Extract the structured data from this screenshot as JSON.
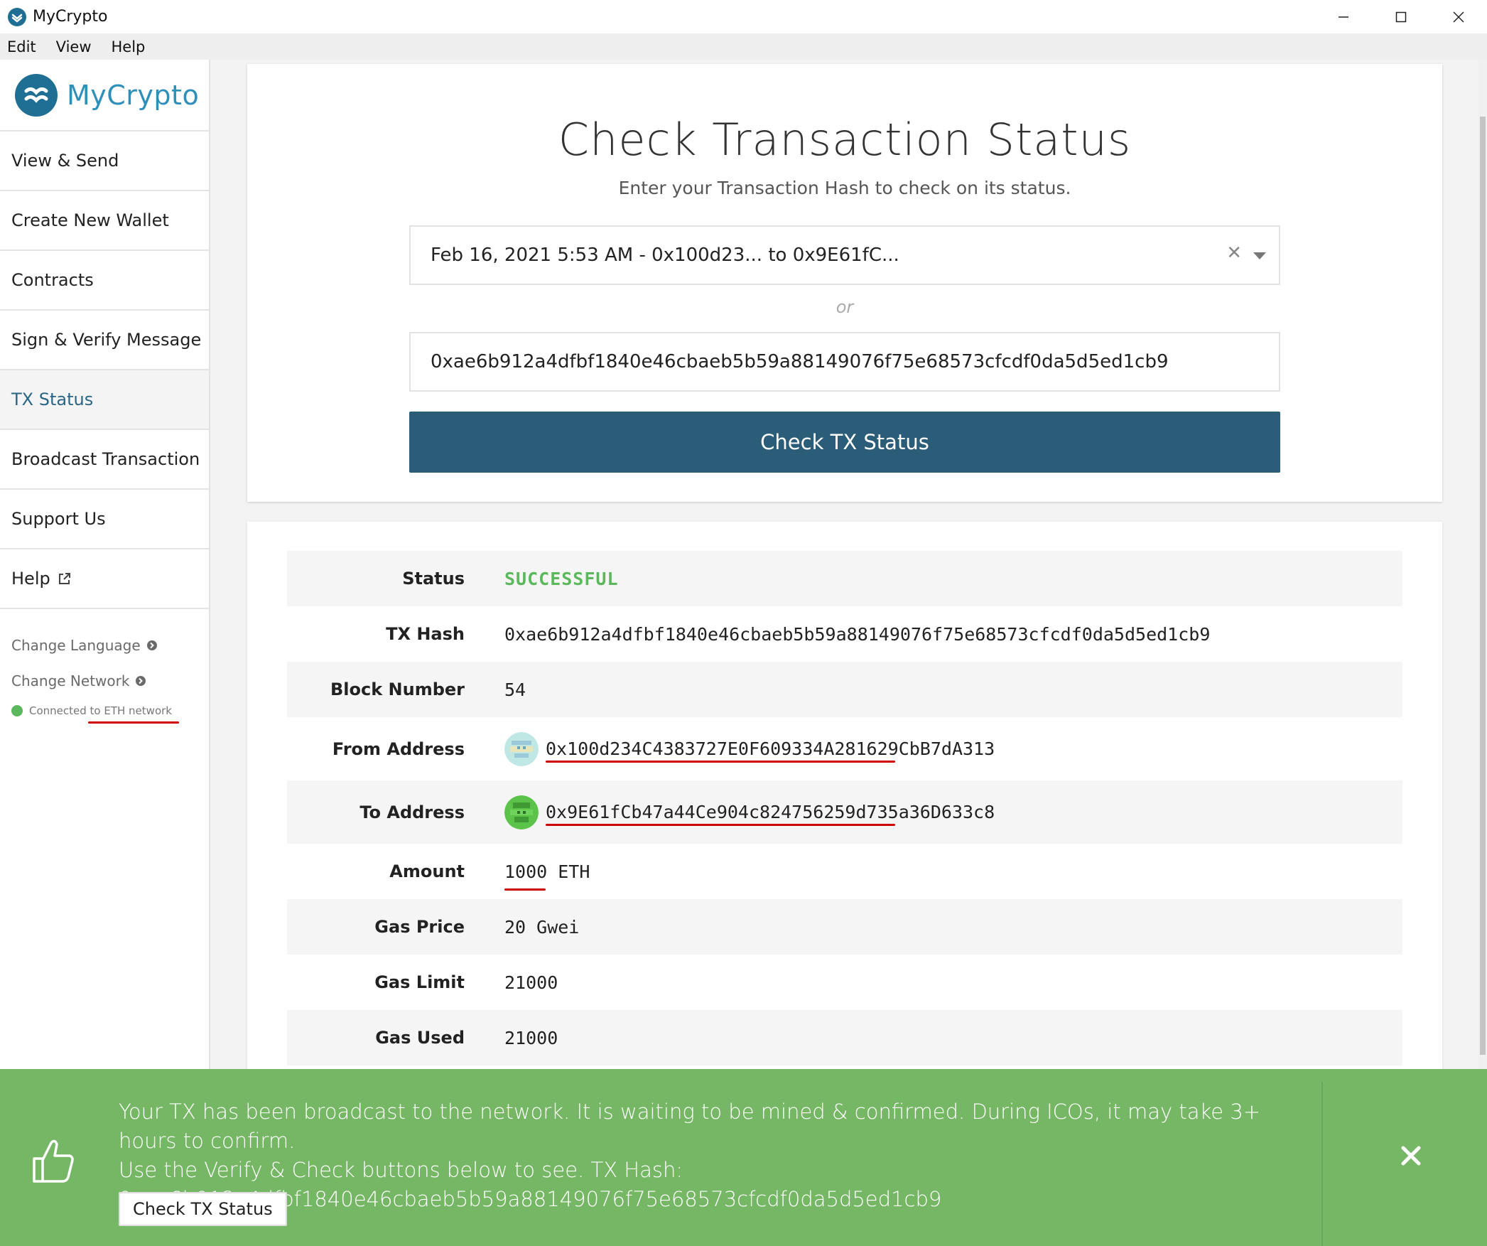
{
  "window": {
    "title": "MyCrypto",
    "controls": [
      "minimize",
      "maximize",
      "close"
    ]
  },
  "menu": [
    "Edit",
    "View",
    "Help"
  ],
  "sidebar": {
    "brand": "MyCrypto",
    "items": [
      {
        "label": "View & Send"
      },
      {
        "label": "Create New Wallet"
      },
      {
        "label": "Contracts"
      },
      {
        "label": "Sign & Verify Message"
      },
      {
        "label": "TX Status",
        "active": true
      },
      {
        "label": "Broadcast Transaction"
      },
      {
        "label": "Support Us"
      },
      {
        "label": "Help"
      }
    ],
    "change_language": "Change Language",
    "change_network": "Change Network",
    "network_status": "Connected to ETH network"
  },
  "main": {
    "title": "Check Transaction Status",
    "subtitle": "Enter your Transaction Hash to check on its status.",
    "recent_tx_select": "Feb 16, 2021 5:53 AM - 0x100d23... to 0x9E61fC...",
    "or": "or",
    "hash_input_value": "0xae6b912a4dfbf1840e46cbaeb5b59a88149076f75e68573cfcdf0da5d5ed1cb9",
    "check_button": "Check TX Status"
  },
  "details": {
    "status": {
      "label": "Status",
      "value": "SUCCESSFUL"
    },
    "tx_hash": {
      "label": "TX Hash",
      "value": "0xae6b912a4dfbf1840e46cbaeb5b59a88149076f75e68573cfcdf0da5d5ed1cb9"
    },
    "block_number": {
      "label": "Block Number",
      "value": "54"
    },
    "from_address": {
      "label": "From Address",
      "value": "0x100d234C4383727E0F609334A281629CbB7dA313"
    },
    "to_address": {
      "label": "To Address",
      "value": "0x9E61fCb47a44Ce904c824756259d735a36D633c8"
    },
    "amount": {
      "label": "Amount",
      "value": "1000",
      "unit": "ETH"
    },
    "gas_price": {
      "label": "Gas Price",
      "value": "20 Gwei"
    },
    "gas_limit": {
      "label": "Gas Limit",
      "value": "21000"
    },
    "gas_used": {
      "label": "Gas Used",
      "value": "21000"
    }
  },
  "notification": {
    "line1": "Your TX has been broadcast to the network. It is waiting to be mined & confirmed. During ICOs, it may take 3+ hours to confirm.",
    "line2": "Use the Verify & Check buttons below to see. TX Hash:",
    "line3": "0xae6b912a4dfbf1840e46cbaeb5b59a88149076f75e68573cfcdf0da5d5ed1cb9",
    "button": "Check TX Status"
  },
  "colors": {
    "brand": "#2d8fba",
    "primary_button": "#2b5d78",
    "success": "#5cb85c",
    "notification_bg": "#76b765",
    "annotation_red": "#cc0000"
  }
}
